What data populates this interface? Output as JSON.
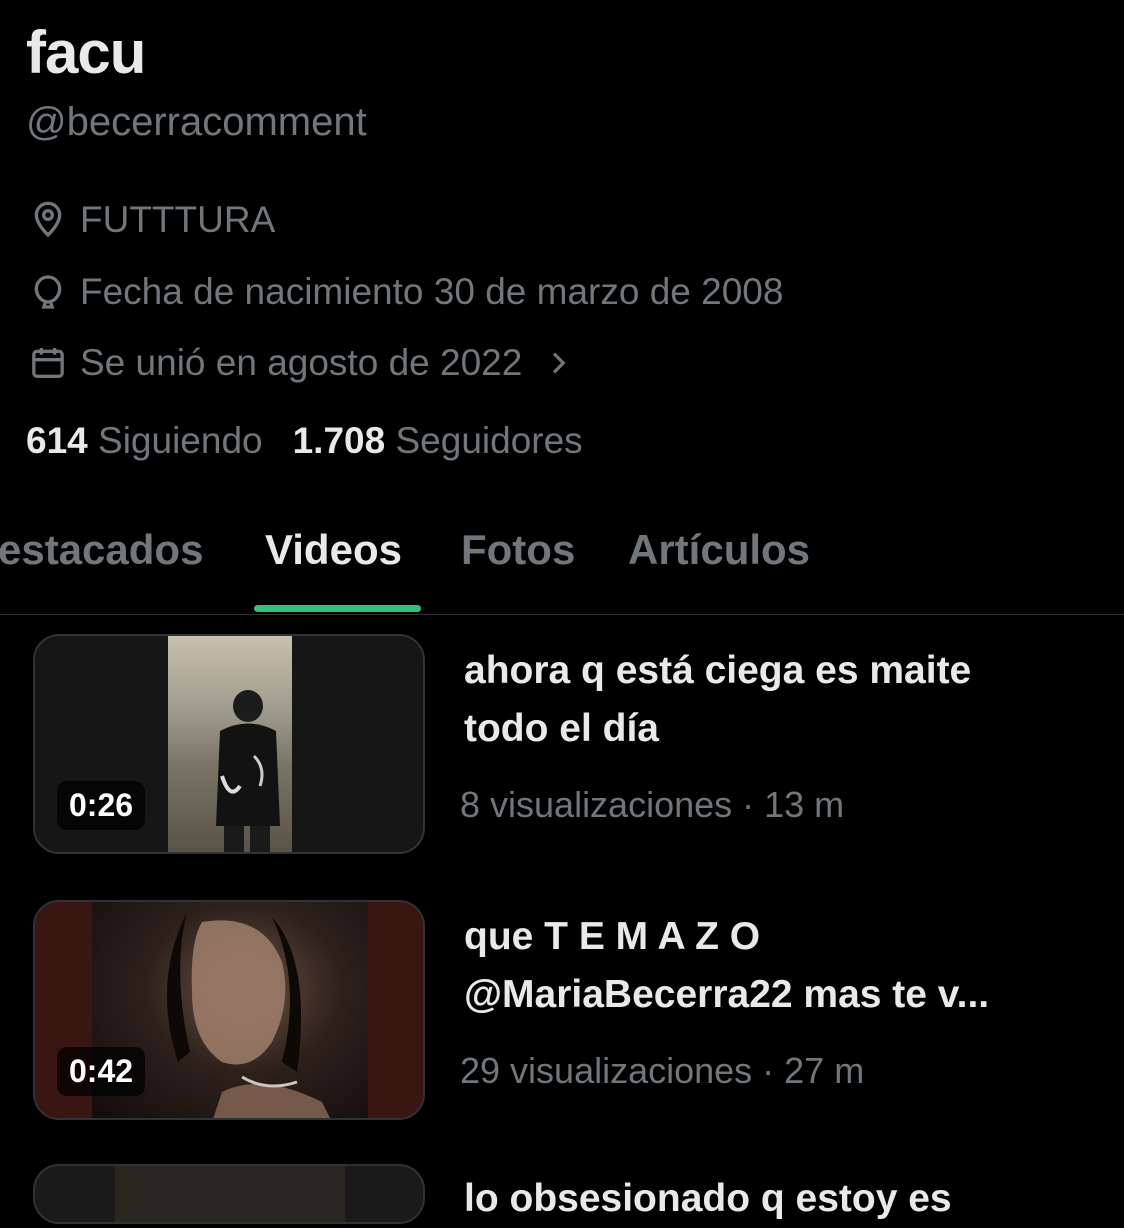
{
  "profile": {
    "display_name": "facu",
    "handle": "@becerracomment",
    "location": "FUTTTURA",
    "birthday": "Fecha de nacimiento 30 de marzo de 2008",
    "joined": "Se unió en agosto de 2022",
    "following_count": "614",
    "following_label": "Siguiendo",
    "followers_count": "1.708",
    "followers_label": "Seguidores"
  },
  "tabs": [
    {
      "label": "estacados",
      "active": false
    },
    {
      "label": "Videos",
      "active": true
    },
    {
      "label": "Fotos",
      "active": false
    },
    {
      "label": "Artículos",
      "active": false
    }
  ],
  "videos": [
    {
      "duration": "0:26",
      "title_line1": "ahora q está ciega es maite",
      "title_line2": "todo el día",
      "meta": "8 visualizaciones · 13 m"
    },
    {
      "duration": "0:42",
      "title_line1": "que T E M A Z O",
      "title_line2": "@MariaBecerra22 mas te v...",
      "meta": "29 visualizaciones · 27 m"
    },
    {
      "title_line1": "lo obsesionado q estoy es"
    }
  ],
  "colors": {
    "background": "#000000",
    "text_primary": "#e7e9ea",
    "text_secondary": "#71767b",
    "tab_indicator": "#35c07a"
  },
  "icons": {
    "location": "location-pin-icon",
    "birthday": "balloon-icon",
    "joined": "calendar-icon",
    "joined_more": "chevron-right-icon"
  }
}
